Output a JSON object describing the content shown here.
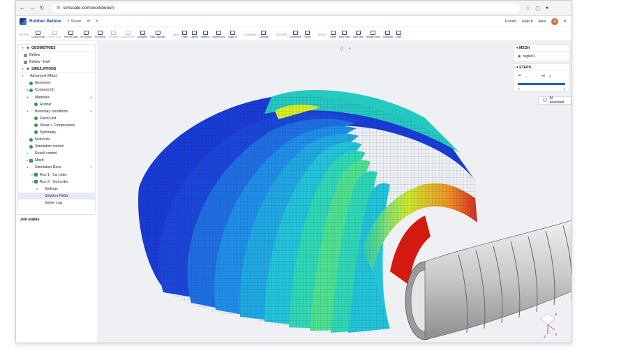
{
  "browser": {
    "url": "simscale.com/workbench",
    "user": "Alex"
  },
  "app": {
    "title": "Rubber Bellow",
    "share_label": "Share",
    "forum_label": "Forum",
    "help_label": "Help",
    "user_name": "Alex",
    "avatar_initial": "A"
  },
  "toolbar": {
    "groups": [
      {
        "label": "FILTERS",
        "items": [
          "Cutting Plane",
          "Particle Trace",
          "Plot over path",
          "Iso Surface",
          "Iso Volume",
          "Resample",
          "Displacement",
          "Animation",
          "Field Calculator"
        ]
      },
      {
        "label": "VIEW",
        "items": [
          "Filters",
          "Legend",
          "Statistics",
          "Inspect point",
          "Toggle UI"
        ]
      },
      {
        "label": "COMPARE",
        "items": [
          "Compare"
        ]
      },
      {
        "label": "CAPTURE",
        "items": [
          "Screenshot",
          "Record"
        ]
      },
      {
        "label": "RESULT",
        "items": [
          "Reset",
          "Import view",
          "Save view",
          "Manage views",
          "Download",
          "Share"
        ]
      }
    ],
    "beta_badge": "BETA"
  },
  "left_panel": {
    "geometries_header": "GEOMETRIES",
    "geometries": [
      "Bellow",
      "Bellow - Half"
    ],
    "simulations_header": "SIMULATIONS",
    "tree": [
      {
        "label": "Advanced (Marc)",
        "level": 0,
        "icon": "none",
        "chev": "v"
      },
      {
        "label": "Geometry",
        "level": 1,
        "icon": "ok"
      },
      {
        "label": "Contacts (1)",
        "level": 1,
        "icon": "ok",
        "chev": ">"
      },
      {
        "label": "Materials",
        "level": 1,
        "icon": "none",
        "chev": "v",
        "plus": true
      },
      {
        "label": "Rubber",
        "level": 2,
        "icon": "ok"
      },
      {
        "label": "Boundary conditions",
        "level": 1,
        "icon": "none",
        "chev": "v",
        "plus": true
      },
      {
        "label": "Fixed End",
        "level": 2,
        "icon": "ok"
      },
      {
        "label": "Shear + Compression",
        "level": 2,
        "icon": "ok"
      },
      {
        "label": "Symmetry",
        "level": 2,
        "icon": "ok"
      },
      {
        "label": "Numerics",
        "level": 1,
        "icon": "ok"
      },
      {
        "label": "Simulation control",
        "level": 1,
        "icon": "ok"
      },
      {
        "label": "Result control",
        "level": 1,
        "icon": "none",
        "chev": ">"
      },
      {
        "label": "Mesh",
        "level": 1,
        "icon": "mesh",
        "chev": ">"
      },
      {
        "label": "Simulation Runs",
        "level": 1,
        "icon": "none",
        "chev": "v",
        "plus": true
      },
      {
        "label": "Run 1 - 1st order",
        "level": 2,
        "icon": "mesh",
        "chev": ">"
      },
      {
        "label": "Run 2 - 2nd order",
        "level": 2,
        "icon": "mesh",
        "chev": "v"
      },
      {
        "label": "Settings",
        "level": 3,
        "icon": "none",
        "chev": ">"
      },
      {
        "label": "Solution Fields",
        "level": 3,
        "icon": "none",
        "selected": true
      },
      {
        "label": "Solver Log",
        "level": 3,
        "icon": "none"
      }
    ],
    "job_status": "Job status"
  },
  "mesh_panel": {
    "header": "MESH",
    "region": "region1"
  },
  "steps_panel": {
    "header": "STEPS",
    "current": "2",
    "min": "0",
    "max": "2",
    "progress": 1.0
  },
  "ai_assistant": "AI Assistant",
  "gizmo": {
    "x": "X",
    "y": "Y",
    "z": "Z"
  },
  "colors": {
    "accent": "#1f5fbf",
    "ok": "#2e9b46",
    "header_purple": "#7b67d9"
  }
}
